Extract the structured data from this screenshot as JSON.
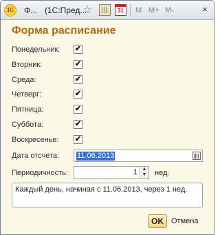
{
  "window": {
    "app_icon_text": "1С",
    "title_prefix": "Ф...",
    "title_tab": "(1С:Пред...",
    "toolbar": {
      "star_icon": "star-icon",
      "calculator_icon": "calculator-icon",
      "calendar_icon": "calendar-icon",
      "calendar_day": "31",
      "m_label": "M",
      "m_plus_label": "M+",
      "m_minus_label": "M-"
    },
    "close_glyph": "×"
  },
  "form": {
    "title": "Форма расписание",
    "weekdays": [
      {
        "label": "Понедельник:",
        "checked": true
      },
      {
        "label": "Вторник:",
        "checked": true
      },
      {
        "label": "Среда:",
        "checked": true
      },
      {
        "label": "Четверг:",
        "checked": true
      },
      {
        "label": "Пятница:",
        "checked": true
      },
      {
        "label": "Суббота:",
        "checked": true
      },
      {
        "label": "Воскресенье:",
        "checked": true
      }
    ],
    "check_glyph": "✔",
    "start_date": {
      "label": "Дата отсчета:",
      "value": "11.06.2013"
    },
    "periodicity": {
      "label": "Периодичность:",
      "value": "1",
      "unit": "нед."
    },
    "summary": "Каждый день, начиная с 11.06.2013, через 1 нед."
  },
  "buttons": {
    "ok": "OK",
    "cancel": "Отмена"
  },
  "colors": {
    "title_accent": "#b26a12",
    "background": "#fcf8e8",
    "selection": "#3d6fc9"
  }
}
